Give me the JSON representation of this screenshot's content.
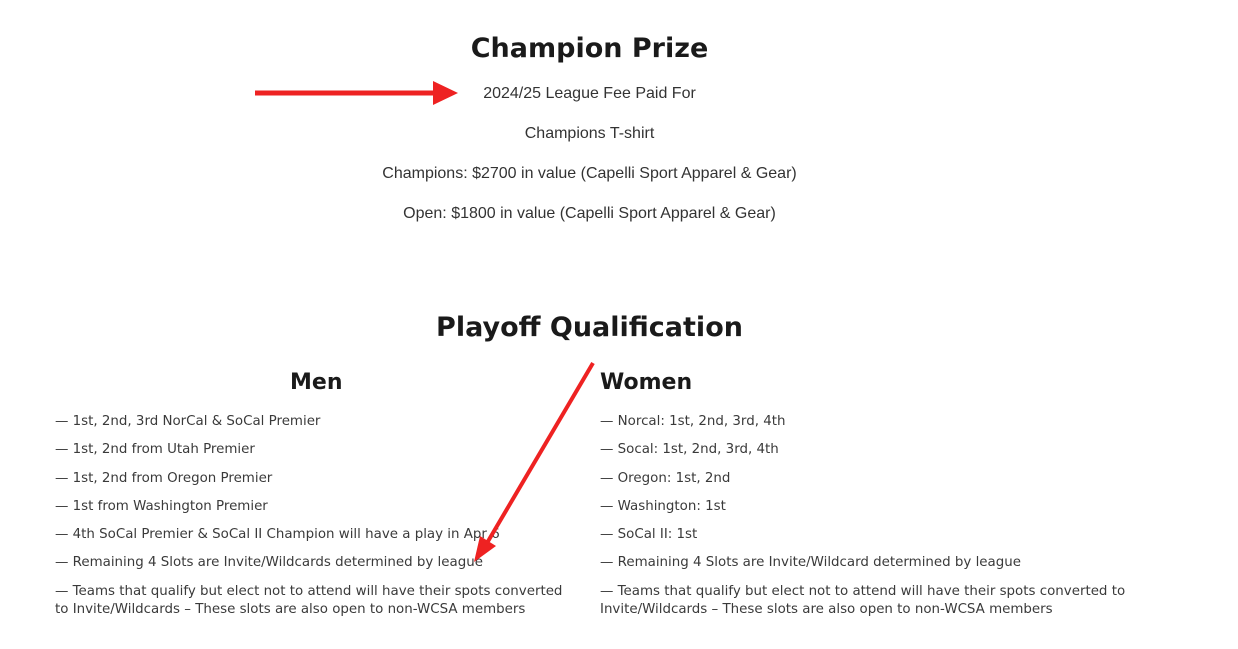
{
  "champion_prize": {
    "title": "Champion Prize",
    "lines": [
      "2024/25 League Fee Paid For",
      "Champions T-shirt",
      "Champions: $2700 in value (Capelli Sport Apparel & Gear)",
      "Open: $1800 in value (Capelli Sport Apparel & Gear)"
    ]
  },
  "playoff": {
    "title": "Playoff Qualification",
    "men": {
      "heading": "Men",
      "items": [
        "— 1st, 2nd, 3rd NorCal & SoCal Premier",
        "— 1st, 2nd from Utah Premier",
        "— 1st, 2nd from Oregon Premier",
        "— 1st from Washington Premier",
        "— 4th SoCal Premier & SoCal II Champion will have a play in Apr 6",
        "— Remaining 4 Slots are Invite/Wildcards determined by league",
        "— Teams that qualify but elect not to attend will have their spots converted to Invite/Wildcards – These slots are also open to non-WCSA members"
      ]
    },
    "women": {
      "heading": "Women",
      "items": [
        "— Norcal: 1st, 2nd, 3rd, 4th",
        "— Socal: 1st, 2nd, 3rd, 4th",
        "— Oregon: 1st, 2nd",
        "— Washington: 1st",
        "— SoCal II: 1st",
        "— Remaining 4 Slots are Invite/Wildcard determined by league",
        "— Teams that qualify but elect not to attend will have their spots converted to Invite/Wildcards – These slots are also open to non-WCSA members"
      ]
    }
  },
  "annotations": {
    "arrow_color": "#ee2222",
    "arrows": [
      "red-arrow-right",
      "red-arrow-down-left"
    ]
  }
}
